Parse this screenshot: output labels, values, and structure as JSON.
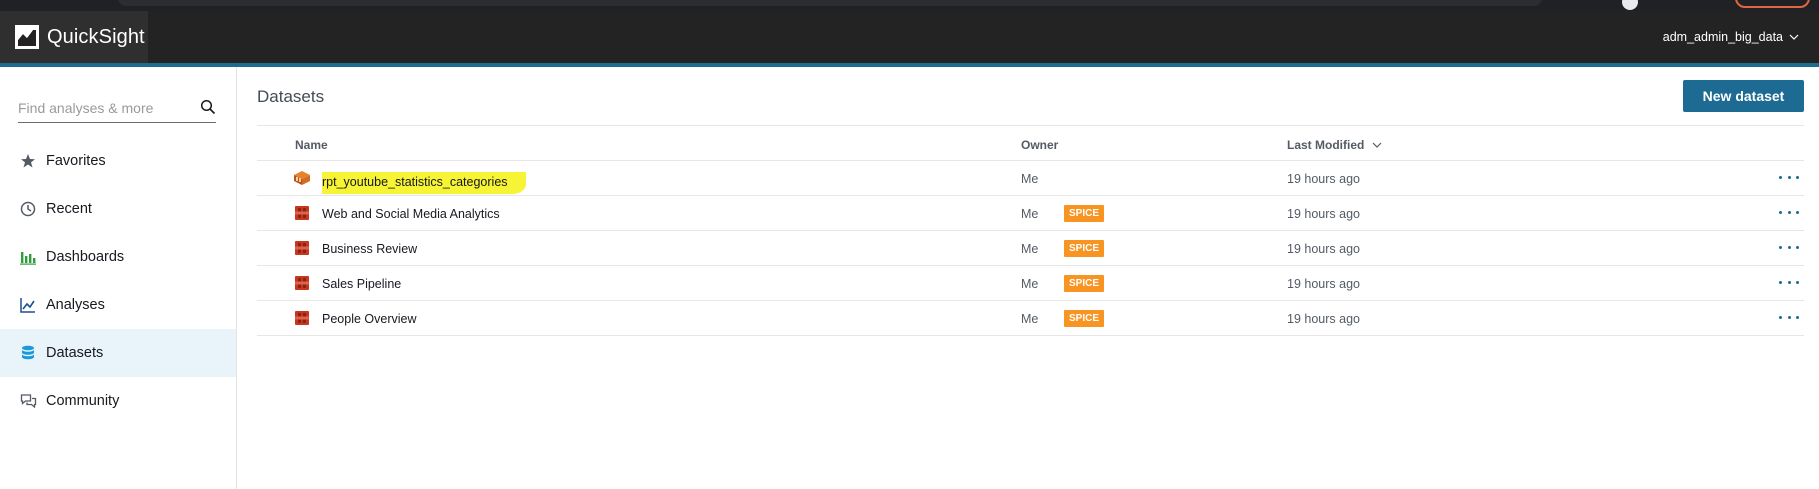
{
  "app": {
    "brand_name": "QuickSight",
    "user_name": "adm_admin_big_data",
    "accent_color": "#1b6c8f",
    "primary_button_color": "#1d6a93"
  },
  "sidebar": {
    "search_placeholder": "Find analyses & more",
    "items": [
      {
        "label": "Favorites",
        "icon": "star-icon"
      },
      {
        "label": "Recent",
        "icon": "clock-icon"
      },
      {
        "label": "Dashboards",
        "icon": "dashboard-icon"
      },
      {
        "label": "Analyses",
        "icon": "line-chart-icon"
      },
      {
        "label": "Datasets",
        "icon": "database-icon",
        "active": true
      },
      {
        "label": "Community",
        "icon": "chat-icon"
      }
    ]
  },
  "main": {
    "title": "Datasets",
    "new_button": "New dataset",
    "columns": {
      "name": "Name",
      "owner": "Owner",
      "last_modified": "Last Modified"
    },
    "rows": [
      {
        "name": "rpt_youtube_statistics_categories",
        "badge": "",
        "owner": "Me",
        "modified": "19 hours ago",
        "icon": "athena-icon",
        "highlighted": true
      },
      {
        "name": "Web and Social Media Analytics",
        "badge": "SPICE",
        "owner": "Me",
        "modified": "19 hours ago",
        "icon": "s3-icon"
      },
      {
        "name": "Business Review",
        "badge": "SPICE",
        "owner": "Me",
        "modified": "19 hours ago",
        "icon": "s3-icon"
      },
      {
        "name": "Sales Pipeline",
        "badge": "SPICE",
        "owner": "Me",
        "modified": "19 hours ago",
        "icon": "s3-icon"
      },
      {
        "name": "People Overview",
        "badge": "SPICE",
        "owner": "Me",
        "modified": "19 hours ago",
        "icon": "s3-icon"
      }
    ]
  }
}
